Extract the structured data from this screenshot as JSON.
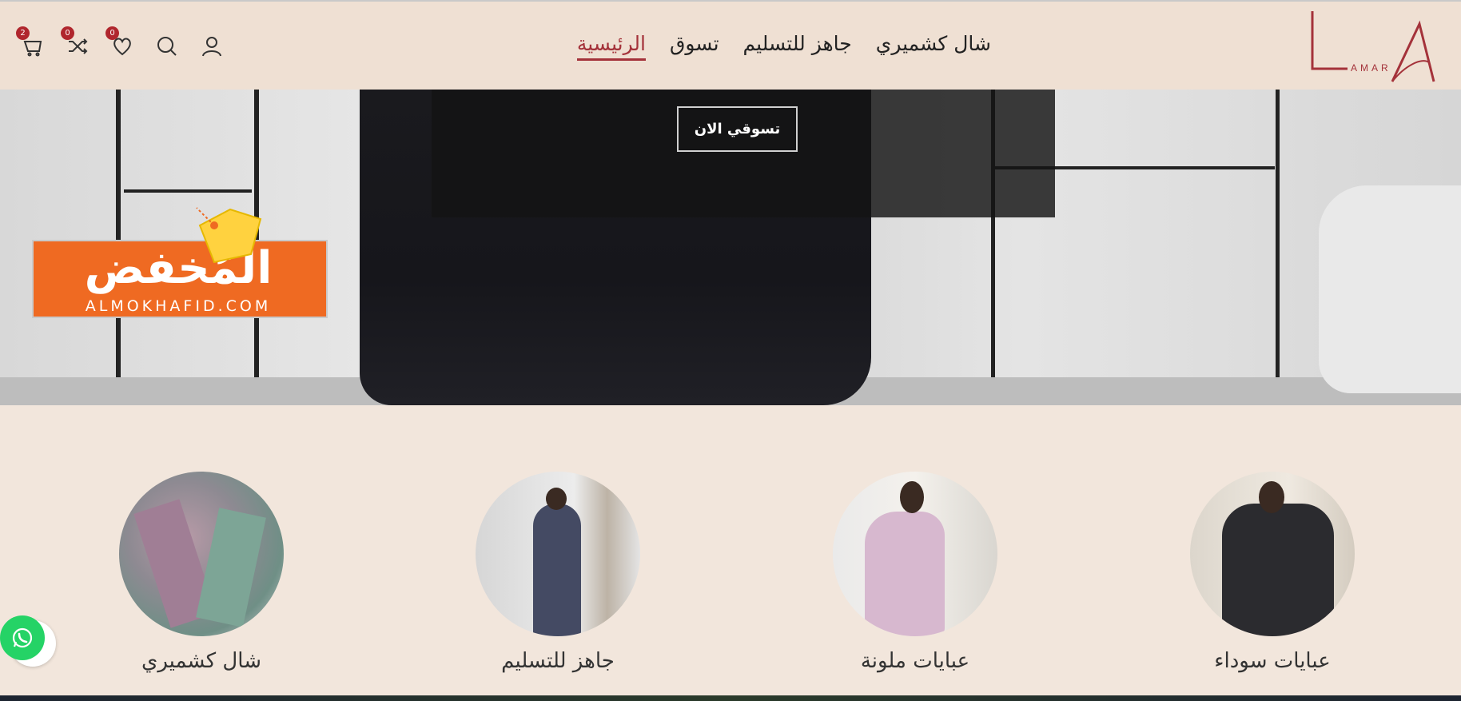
{
  "header": {
    "nav": [
      {
        "label": "الرئيسية",
        "active": true
      },
      {
        "label": "تسوق",
        "active": false
      },
      {
        "label": "جاهز للتسليم",
        "active": false
      },
      {
        "label": "شال كشميري",
        "active": false
      }
    ],
    "logo_text": "AMAR",
    "icons": {
      "cart_count": "2",
      "compare_count": "0",
      "wishlist_count": "0"
    }
  },
  "hero": {
    "cta_label": "تسوقي الان"
  },
  "watermark": {
    "arabic": "المُخفض",
    "latin": "ALMOKHAFID.COM"
  },
  "categories": [
    {
      "label": "شال كشميري"
    },
    {
      "label": "جاهز للتسليم"
    },
    {
      "label": "عبايات ملونة"
    },
    {
      "label": "عبايات سوداء"
    }
  ],
  "colors": {
    "accent": "#a4323a",
    "header_bg": "#efe0d3",
    "page_bg": "#f2e6dc",
    "badge": "#b0262d",
    "whatsapp": "#25d366"
  }
}
